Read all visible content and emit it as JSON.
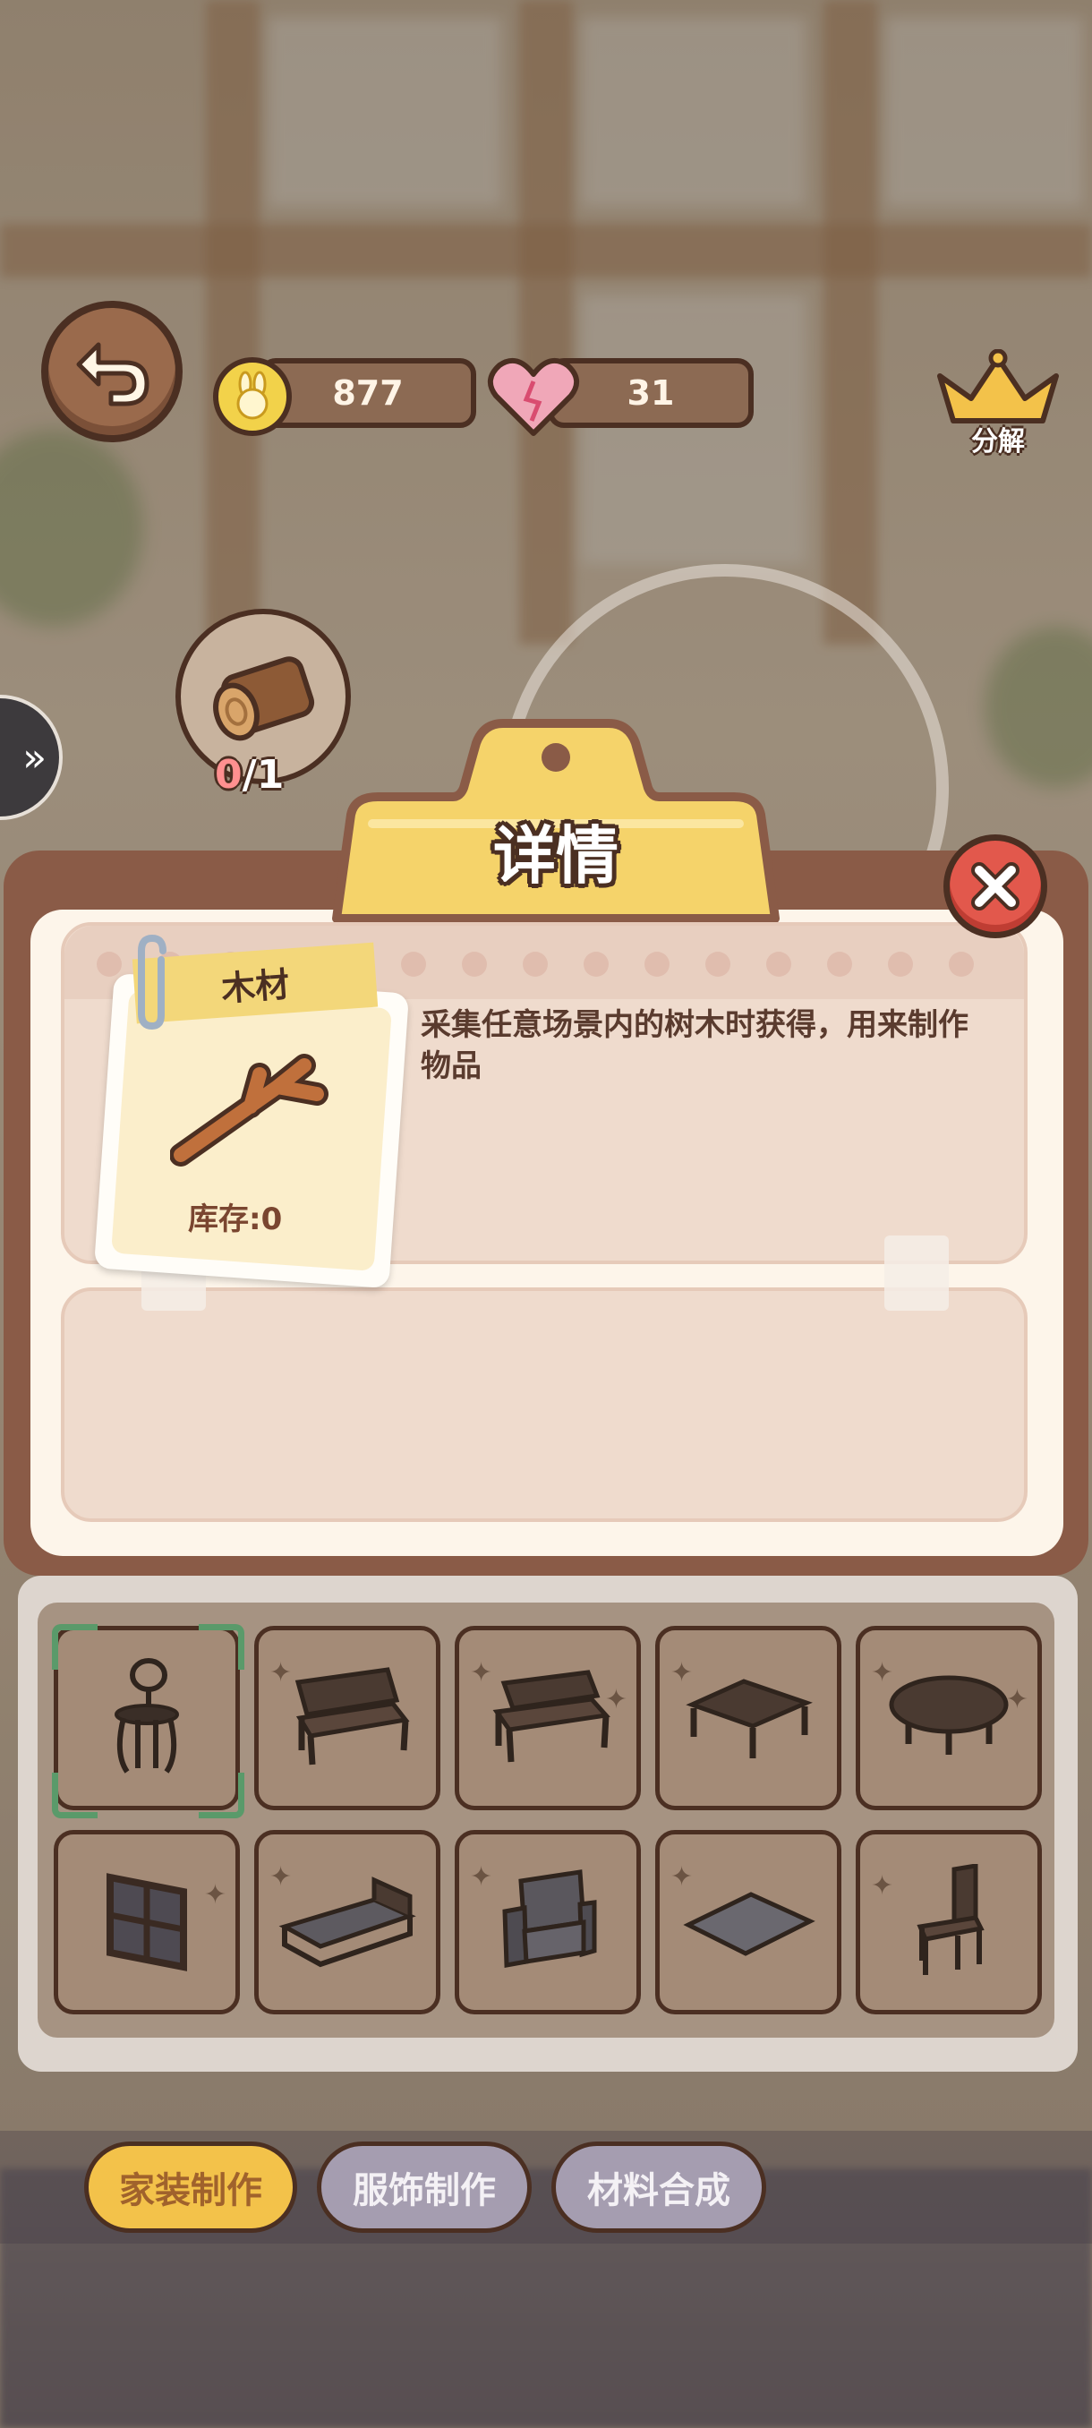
{
  "hud": {
    "coins": "877",
    "hearts": "31",
    "decompose_label": "分解"
  },
  "requirement": {
    "have": "0",
    "need": "/1"
  },
  "detail": {
    "title": "详情",
    "item_name": "木材",
    "stock_label": "库存:0",
    "description": "采集任意场景内的树木时获得，用来制作物品"
  },
  "grid": {
    "items": [
      "chair-icon",
      "bench-icon",
      "bench-simple-icon",
      "table-rect-icon",
      "table-round-icon",
      "window-icon",
      "bed-icon",
      "armchair-icon",
      "rug-icon",
      "wooden-chair-icon"
    ],
    "selected_index": 0
  },
  "tabs": [
    {
      "label": "家装制作",
      "active": true
    },
    {
      "label": "服饰制作",
      "active": false
    },
    {
      "label": "材料合成",
      "active": false
    }
  ],
  "colors": {
    "outline": "#4b2f22",
    "gold": "#f3c24a",
    "close_red": "#e2584c",
    "select_green": "#5a9a6a"
  }
}
